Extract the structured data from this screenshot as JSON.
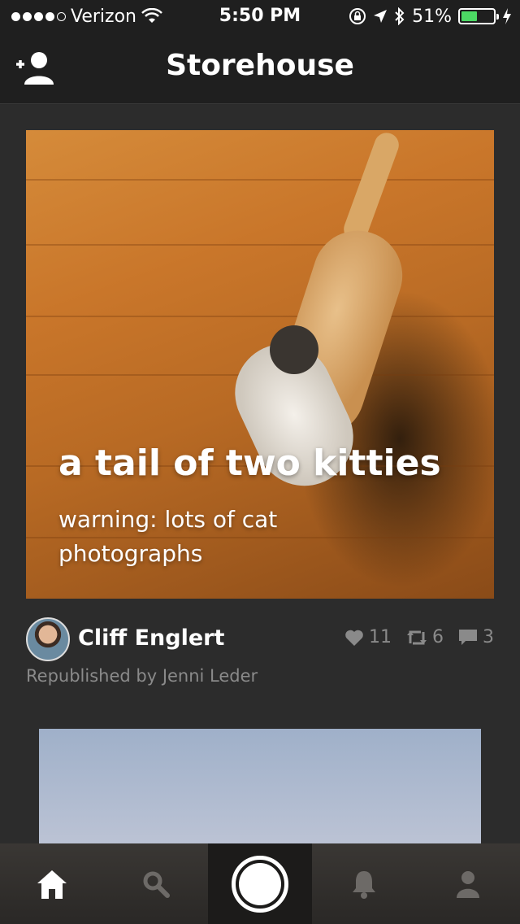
{
  "status_bar": {
    "carrier": "Verizon",
    "time": "5:50 PM",
    "battery": "51%",
    "battery_level": 0.51,
    "signal_bars": 4,
    "signal_max": 5
  },
  "nav": {
    "title": "Storehouse",
    "left_icon": "add-user-icon"
  },
  "story": {
    "title": "a tail of two kitties",
    "subtitle": "warning: lots of cat photographs",
    "author": "Cliff Englert",
    "republished": "Republished by Jenni Leder",
    "likes": "11",
    "reposts": "6",
    "comments": "3"
  },
  "tabs": [
    {
      "name": "home",
      "icon": "home-icon"
    },
    {
      "name": "search",
      "icon": "search-icon"
    },
    {
      "name": "camera",
      "icon": "camera-shutter-icon"
    },
    {
      "name": "notifications",
      "icon": "bell-icon"
    },
    {
      "name": "profile",
      "icon": "person-icon"
    }
  ],
  "colors": {
    "background": "#2c2c2c",
    "bar": "#1f1f1f",
    "muted_text": "#8a8a8a",
    "battery_fill": "#4cd964"
  }
}
